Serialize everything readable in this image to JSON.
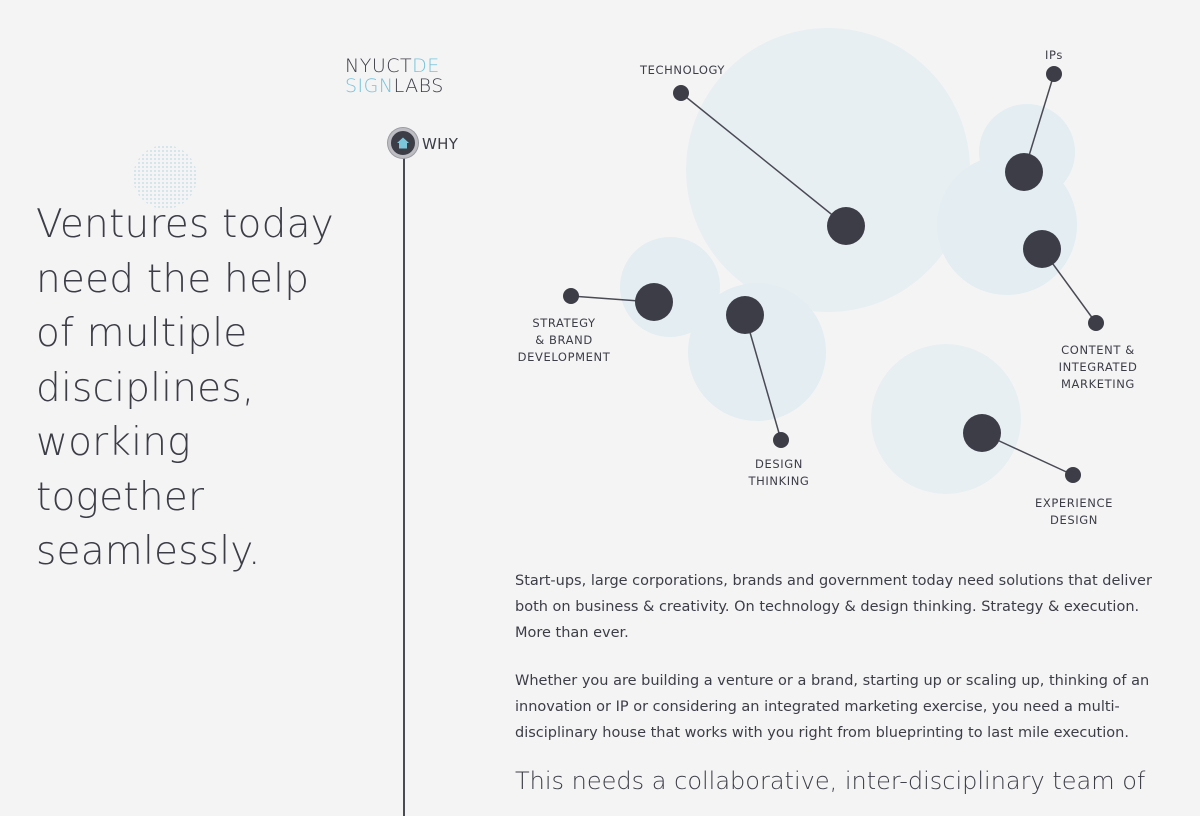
{
  "brand": {
    "logo_line1_dark": "NYUCT",
    "logo_line1_accent": "DE",
    "logo_line2_accent": "SIGN",
    "logo_line2_dark": "LABS",
    "accent_color": "#76c3da",
    "text_color": "#3d3d48"
  },
  "nav": {
    "current_section": "WHY",
    "icon": "home-icon"
  },
  "hero": {
    "headline": "Ventures today need the help of multiple disciplines, working together seamlessly."
  },
  "disciplines_diagram": {
    "labels": [
      "TECHNOLOGY",
      "IPs",
      "STRATEGY\n& BRAND\nDEVELOPMENT",
      "CONTENT &\nINTEGRATED\nMARKETING",
      "DESIGN\nTHINKING",
      "EXPERIENCE\nDESIGN"
    ]
  },
  "body": {
    "paragraph1": "Start-ups, large corporations, brands and government today need solutions that deliver both on business & creativity. On technology & design thinking. Strategy & execution. More than ever.",
    "paragraph2": "Whether you are building a venture or a brand, starting up or scaling up, thinking of an innovation or IP or considering an integrated marketing exercise, you need a multi-disciplinary house that works with you right from blueprinting to last mile execution.",
    "subheading": "This needs a collaborative, inter-disciplinary team of"
  }
}
